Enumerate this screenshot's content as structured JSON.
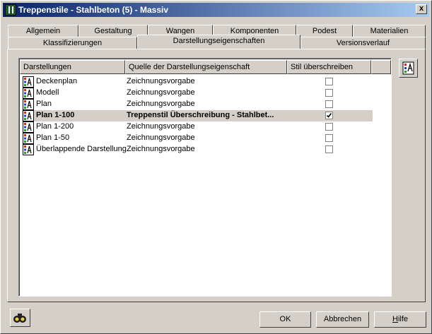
{
  "window": {
    "title": "Treppenstile - Stahlbeton (5) - Massiv",
    "close_label": "x"
  },
  "tabs": {
    "row_back": [
      {
        "label": "Allgemein"
      },
      {
        "label": "Gestaltung"
      },
      {
        "label": "Wangen"
      },
      {
        "label": "Komponenten"
      },
      {
        "label": "Podest"
      },
      {
        "label": "Materialien"
      }
    ],
    "row_front": [
      {
        "label": "Klassifizierungen"
      },
      {
        "label": "Darstellungseigenschaften"
      },
      {
        "label": "Versionsverlauf"
      }
    ],
    "active": "Darstellungseigenschaften"
  },
  "list": {
    "columns": [
      "Darstellungen",
      "Quelle der Darstellungseigenschaft",
      "Stil überschreiben"
    ],
    "rows": [
      {
        "name": "Deckenplan",
        "source": "Zeichnungsvorgabe",
        "override": false,
        "selected": false,
        "icon": "display-rep-icon"
      },
      {
        "name": "Modell",
        "source": "Zeichnungsvorgabe",
        "override": false,
        "selected": false,
        "icon": "display-rep-icon"
      },
      {
        "name": "Plan",
        "source": "Zeichnungsvorgabe",
        "override": false,
        "selected": false,
        "icon": "display-rep-icon"
      },
      {
        "name": "Plan 1-100",
        "source": "Treppenstil Überschreibung - Stahlbet...",
        "override": true,
        "selected": true,
        "icon": "display-rep-icon"
      },
      {
        "name": "Plan 1-200",
        "source": "Zeichnungsvorgabe",
        "override": false,
        "selected": false,
        "icon": "display-rep-icon"
      },
      {
        "name": "Plan 1-50",
        "source": "Zeichnungsvorgabe",
        "override": false,
        "selected": false,
        "icon": "display-rep-icon"
      },
      {
        "name": "Überlappende Darstellung",
        "source": "Zeichnungsvorgabe",
        "override": false,
        "selected": false,
        "icon": "display-rep-icon"
      }
    ]
  },
  "buttons": {
    "ok": "OK",
    "cancel": "Abbrechen",
    "help_first": "H",
    "help_rest": "ilfe"
  },
  "colors": {
    "titlebar_start": "#0a246a",
    "titlebar_end": "#a6caf0",
    "face": "#d4d0c8"
  }
}
